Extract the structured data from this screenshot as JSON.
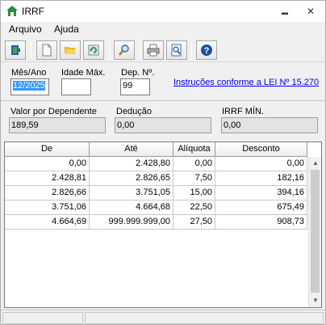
{
  "window": {
    "title": "IRRF",
    "icon": "home-icon"
  },
  "titlebar_controls": {
    "minimize_glyph": "▬",
    "close_glyph": "✕"
  },
  "menu": {
    "items": [
      "Arquivo",
      "Ajuda"
    ]
  },
  "toolbar": {
    "buttons": [
      "exit-door-icon",
      "new-document-icon",
      "open-folder-icon",
      "refresh-icon",
      "search-icon",
      "print-icon",
      "print-preview-icon",
      "help-icon"
    ]
  },
  "form": {
    "mes_ano_label": "Mês/Ano",
    "mes_ano_value": "12/2025",
    "idade_max_label": "Idade Máx.",
    "idade_max_value": "",
    "dep_label": "Dep. Nº.",
    "dep_value": "99",
    "instructions_link": "Instruções conforme a LEI Nº 15.270"
  },
  "summary": {
    "valor_dep_label": "Valor por Dependente",
    "valor_dep_value": "189,59",
    "deducao_label": "Dedução",
    "deducao_value": "0,00",
    "irrf_min_label": "IRRF MÍN.",
    "irrf_min_value": "0,00"
  },
  "table": {
    "headers": [
      "De",
      "Até",
      "Alíquota",
      "Desconto"
    ],
    "rows": [
      [
        "0,00",
        "2.428,80",
        "0,00",
        "0,00"
      ],
      [
        "2.428,81",
        "2.826,65",
        "7,50",
        "182,16"
      ],
      [
        "2.826,66",
        "3.751,05",
        "15,00",
        "394,16"
      ],
      [
        "3.751,06",
        "4.664,68",
        "22,50",
        "675,49"
      ],
      [
        "4.664,69",
        "999.999.999,00",
        "27,50",
        "908,73"
      ]
    ]
  },
  "colors": {
    "link": "#0000ee",
    "selection": "#3399ff"
  }
}
